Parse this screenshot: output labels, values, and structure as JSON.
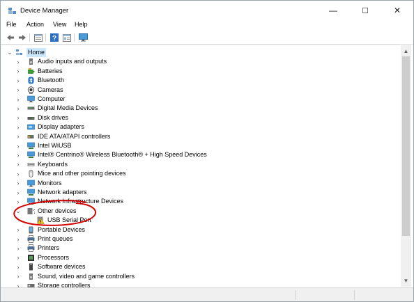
{
  "window": {
    "title": "Device Manager",
    "controls": {
      "minimize": "—",
      "maximize": "☐",
      "close": "✕"
    }
  },
  "menu": [
    "File",
    "Action",
    "View",
    "Help"
  ],
  "toolbar": {
    "buttons": [
      "back-arrow-icon",
      "forward-arrow-icon",
      "properties-icon",
      "help-icon",
      "details-icon",
      "monitor-icon"
    ]
  },
  "tree": {
    "root": {
      "label": "Home",
      "expanded": true
    },
    "items": [
      {
        "label": "Audio inputs and outputs",
        "icon": "speaker-icon",
        "expanded": false
      },
      {
        "label": "Batteries",
        "icon": "battery-icon",
        "expanded": false
      },
      {
        "label": "Bluetooth",
        "icon": "bluetooth-icon",
        "expanded": false
      },
      {
        "label": "Cameras",
        "icon": "camera-icon",
        "expanded": false
      },
      {
        "label": "Computer",
        "icon": "computer-icon",
        "expanded": false
      },
      {
        "label": "Digital Media Devices",
        "icon": "media-device-icon",
        "expanded": false
      },
      {
        "label": "Disk drives",
        "icon": "disk-icon",
        "expanded": false
      },
      {
        "label": "Display adapters",
        "icon": "display-adapter-icon",
        "expanded": false
      },
      {
        "label": "IDE ATA/ATAPI controllers",
        "icon": "ide-controller-icon",
        "expanded": false
      },
      {
        "label": "Intel WiUSB",
        "icon": "network-icon",
        "expanded": false
      },
      {
        "label": "Intel® Centrino® Wireless Bluetooth® + High Speed Devices",
        "icon": "network-icon",
        "expanded": false
      },
      {
        "label": "Keyboards",
        "icon": "keyboard-icon",
        "expanded": false
      },
      {
        "label": "Mice and other pointing devices",
        "icon": "mouse-icon",
        "expanded": false
      },
      {
        "label": "Monitors",
        "icon": "monitor-icon",
        "expanded": false
      },
      {
        "label": "Network adapters",
        "icon": "network-icon",
        "expanded": false
      },
      {
        "label": "Network Infrastructure Devices",
        "icon": "network-icon",
        "expanded": false
      },
      {
        "label": "Other devices",
        "icon": "unknown-device-icon",
        "expanded": true
      },
      {
        "label": "USB Serial Port",
        "icon": "warning-device-icon",
        "child": true
      },
      {
        "label": "Portable Devices",
        "icon": "portable-device-icon",
        "expanded": false
      },
      {
        "label": "Print queues",
        "icon": "printer-icon",
        "expanded": false
      },
      {
        "label": "Printers",
        "icon": "printer-icon",
        "expanded": false
      },
      {
        "label": "Processors",
        "icon": "processor-icon",
        "expanded": false
      },
      {
        "label": "Software devices",
        "icon": "software-device-icon",
        "expanded": false
      },
      {
        "label": "Sound, video and game controllers",
        "icon": "speaker-icon",
        "expanded": false
      },
      {
        "label": "Storage controllers",
        "icon": "storage-controller-icon",
        "expanded": false
      }
    ]
  },
  "colors": {
    "selection": "#cce8ff",
    "annotation": "#d40000",
    "icon_blue": "#2b7bd6"
  }
}
